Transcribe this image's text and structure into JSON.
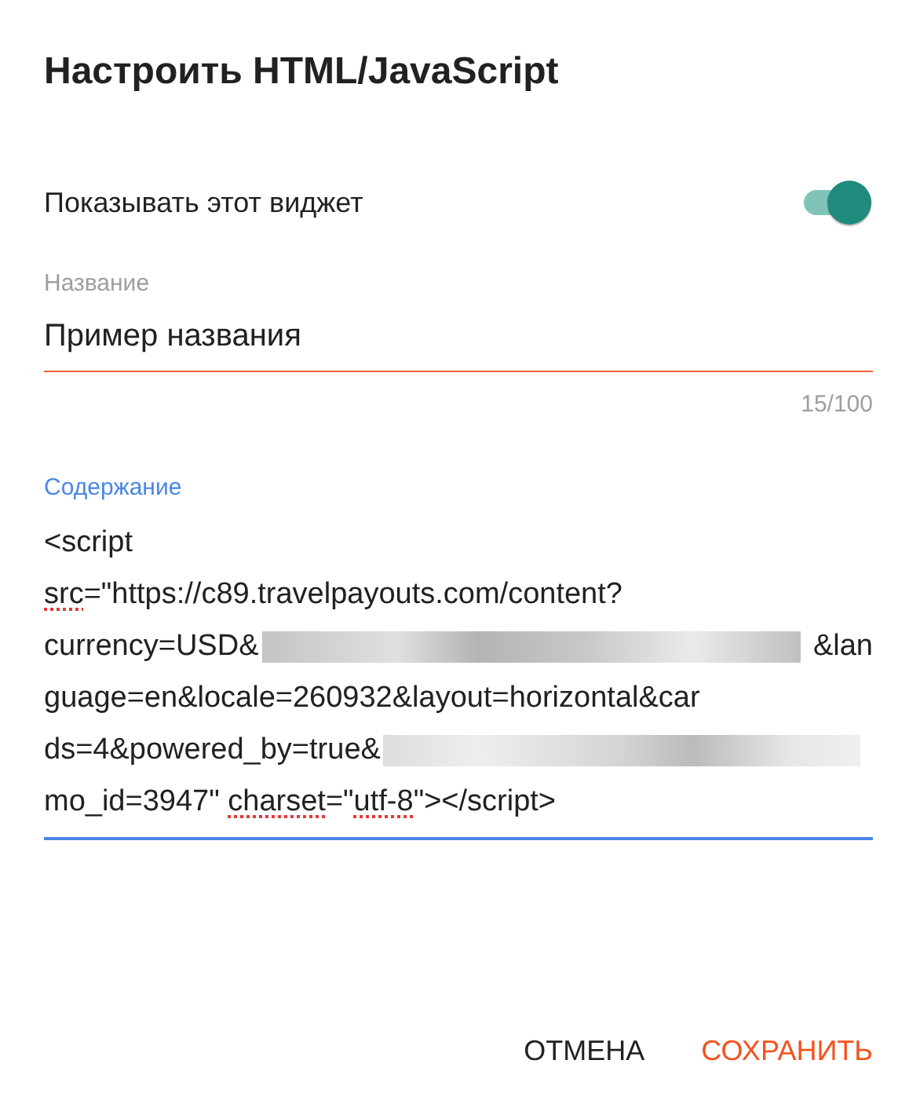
{
  "dialog": {
    "title": "Настроить HTML/JavaScript"
  },
  "visibility": {
    "label": "Показывать этот виджет",
    "on": true
  },
  "title_field": {
    "label": "Название",
    "value": "Пример названия",
    "counter": "15/100",
    "focused": false
  },
  "content_field": {
    "label": "Содержание",
    "focused": true,
    "lines": [
      [
        {
          "kind": "text",
          "text": "<script"
        }
      ],
      [
        {
          "kind": "misspelled",
          "text": "src"
        },
        {
          "kind": "text",
          "text": "=\"https://c89.travelpayouts.com/content?"
        }
      ],
      [
        {
          "kind": "text",
          "text": "currency=USD&"
        },
        {
          "kind": "redacted"
        },
        {
          "kind": "text",
          "text": "&lan"
        }
      ],
      [
        {
          "kind": "text",
          "text": "guage=en&locale=260932&layout=horizontal&car"
        }
      ],
      [
        {
          "kind": "text",
          "text": "ds=4&powered_by=true&"
        },
        {
          "kind": "redacted"
        }
      ],
      [
        {
          "kind": "text",
          "text": "mo_id=3947\" "
        },
        {
          "kind": "misspelled",
          "text": "charset"
        },
        {
          "kind": "text",
          "text": "=\""
        },
        {
          "kind": "misspelled",
          "text": "utf-8"
        },
        {
          "kind": "text",
          "text": "\"></script>"
        }
      ]
    ]
  },
  "buttons": [
    {
      "label": "ОТМЕНА",
      "kind": "secondary"
    },
    {
      "label": "СОХРАНИТЬ",
      "kind": "primary"
    }
  ]
}
